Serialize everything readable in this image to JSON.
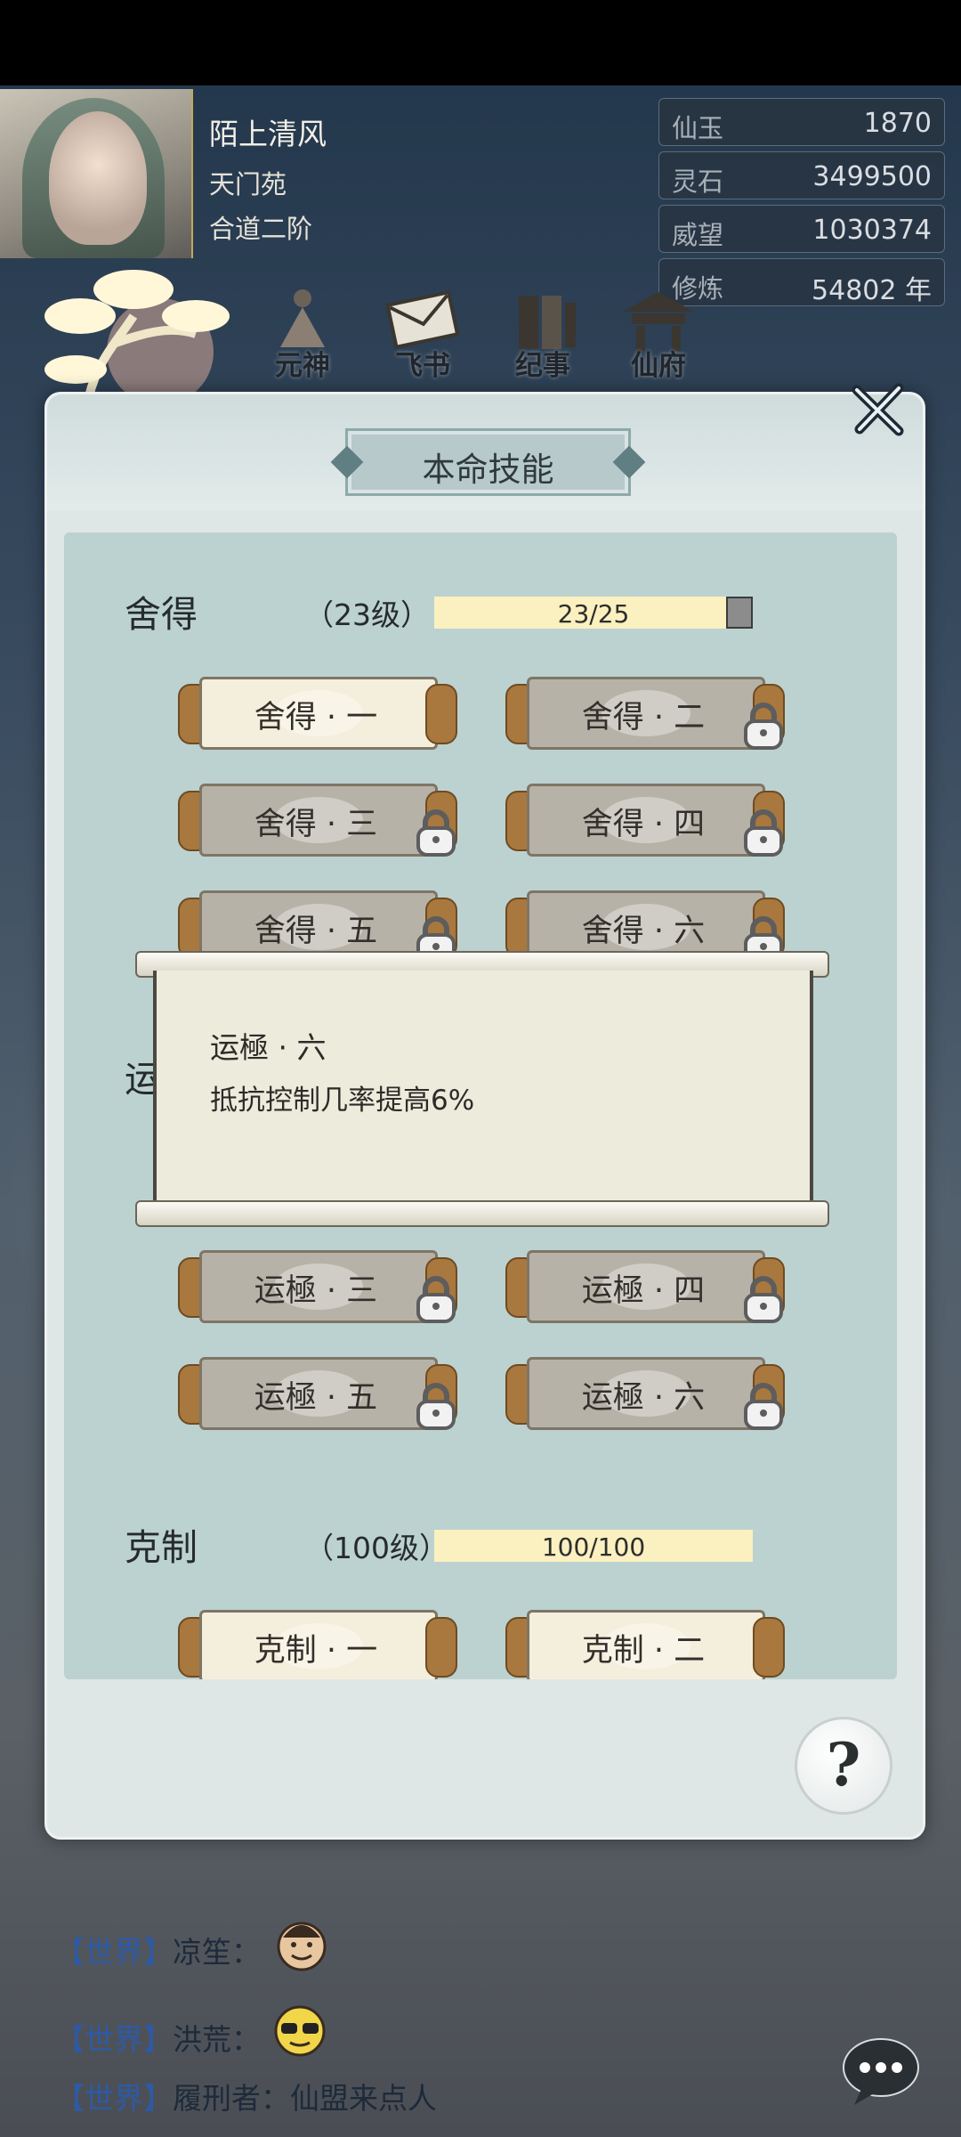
{
  "player": {
    "name": "陌上清风",
    "sect": "天门苑",
    "rank": "合道二阶"
  },
  "stats": [
    {
      "label": "仙玉",
      "value": "1870"
    },
    {
      "label": "灵石",
      "value": "3499500"
    },
    {
      "label": "威望",
      "value": "1030374"
    },
    {
      "label": "修炼",
      "value": "54802 年"
    }
  ],
  "nav": [
    {
      "label": "元神",
      "icon": "meditating-figure-icon"
    },
    {
      "label": "飞书",
      "icon": "letter-icon"
    },
    {
      "label": "纪事",
      "icon": "scroll-book-icon"
    },
    {
      "label": "仙府",
      "icon": "pavilion-icon"
    }
  ],
  "dialog": {
    "title": "本命技能",
    "sections": [
      {
        "name": "舍得",
        "level": "（23级）",
        "progress_text": "23/25",
        "progress": 0.92,
        "skills": [
          {
            "label": "舍得 · 一",
            "locked": false
          },
          {
            "label": "舍得 · 二",
            "locked": true
          },
          {
            "label": "舍得 · 三",
            "locked": true
          },
          {
            "label": "舍得 · 四",
            "locked": true
          },
          {
            "label": "舍得 · 五",
            "locked": true
          },
          {
            "label": "舍得 · 六",
            "locked": true
          }
        ]
      },
      {
        "name": "运",
        "skills": [
          {
            "label": "运極 · 三",
            "locked": true
          },
          {
            "label": "运極 · 四",
            "locked": true
          },
          {
            "label": "运極 · 五",
            "locked": true
          },
          {
            "label": "运極 · 六",
            "locked": true
          }
        ]
      },
      {
        "name": "克制",
        "level": "（100级）",
        "progress_text": "100/100",
        "progress": 1.0,
        "skills": [
          {
            "label": "克制 · 一",
            "locked": false
          },
          {
            "label": "克制 · 二",
            "locked": false
          }
        ]
      }
    ],
    "tooltip": {
      "title": "运極 · 六",
      "desc": "抵抗控制几率提高6%"
    },
    "help": "?"
  },
  "chat": [
    {
      "channel": "【世界】",
      "text": "凉笙：",
      "emoji": "face-emoji"
    },
    {
      "channel": "【世界】",
      "text": "洪荒：",
      "emoji": "sunglasses-emoji"
    },
    {
      "channel": "【世界】",
      "text": "履刑者：仙盟来点人"
    }
  ],
  "colors": {
    "accent_blue": "#2c5aa8",
    "progress_fill": "#fbf0bf",
    "panel": "#bcd2d0"
  }
}
